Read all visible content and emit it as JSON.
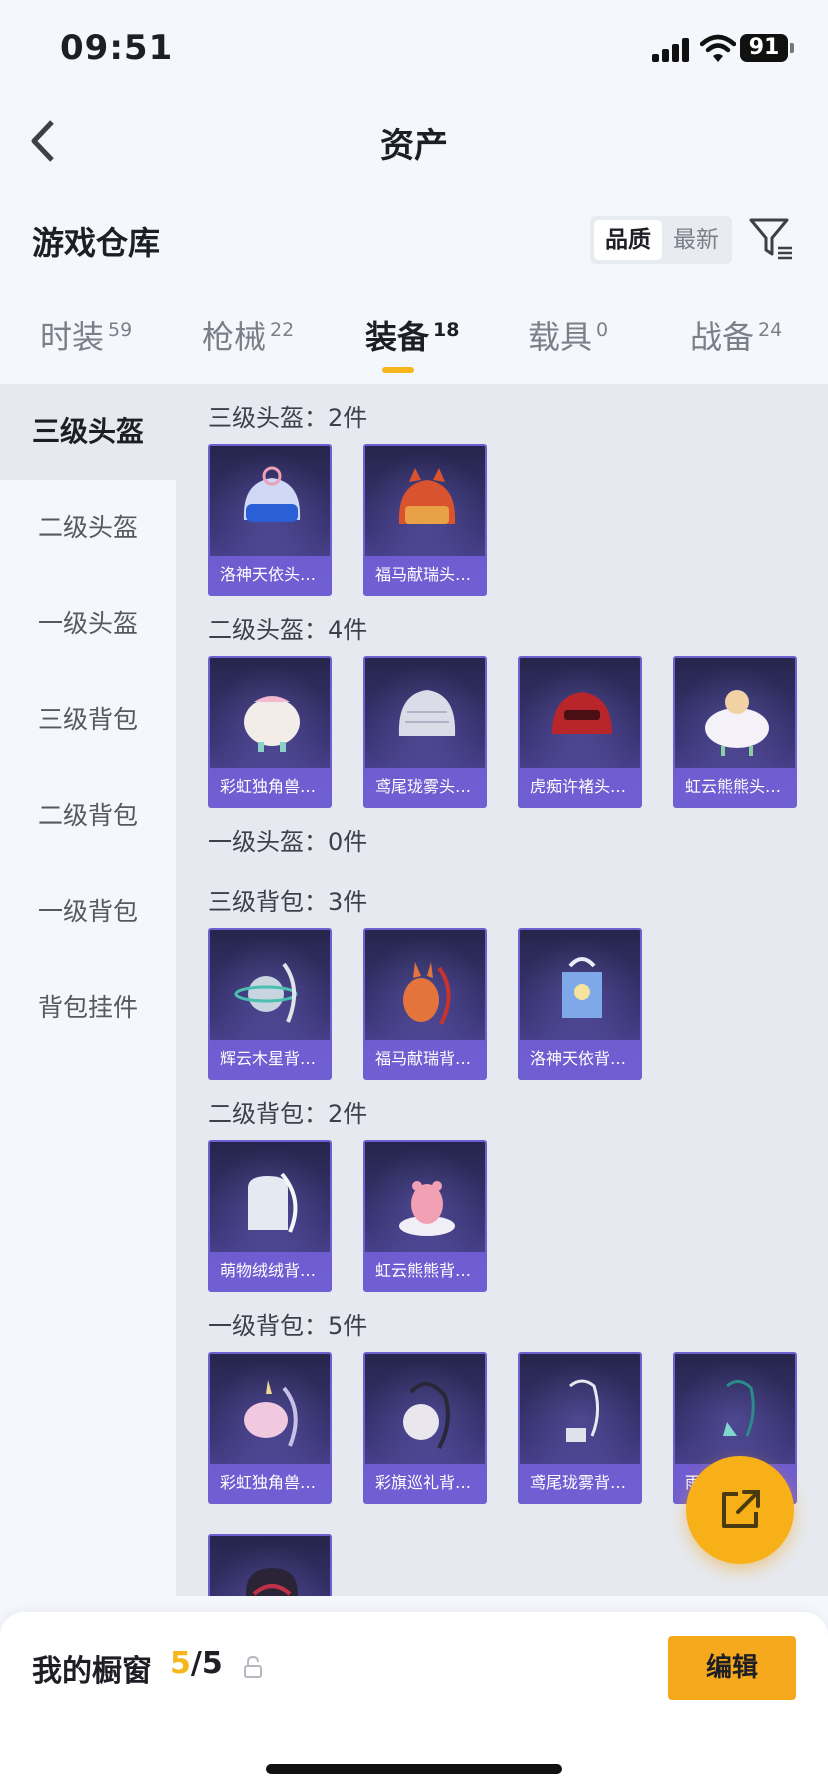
{
  "status": {
    "time": "09:51",
    "battery": "91"
  },
  "nav": {
    "title": "资产"
  },
  "warehouse": {
    "title": "游戏仓库",
    "sort_options": [
      "品质",
      "最新"
    ]
  },
  "tabs": [
    {
      "label": "时装",
      "count": "59"
    },
    {
      "label": "枪械",
      "count": "22"
    },
    {
      "label": "装备",
      "count": "18"
    },
    {
      "label": "载具",
      "count": "0"
    },
    {
      "label": "战备",
      "count": "24"
    }
  ],
  "sidebar": {
    "items": [
      {
        "label": "三级头盔"
      },
      {
        "label": "二级头盔"
      },
      {
        "label": "一级头盔"
      },
      {
        "label": "三级背包"
      },
      {
        "label": "二级背包"
      },
      {
        "label": "一级背包"
      },
      {
        "label": "背包挂件"
      }
    ]
  },
  "sections": [
    {
      "title": "三级头盔：2件",
      "items": [
        "洛神天依头…",
        "福马献瑞头…"
      ]
    },
    {
      "title": "二级头盔：4件",
      "items": [
        "彩虹独角兽…",
        "鸢尾珑雾头…",
        "虎痴许褚头…",
        "虹云熊熊头…"
      ]
    },
    {
      "title": "一级头盔：0件",
      "items": []
    },
    {
      "title": "三级背包：3件",
      "items": [
        "辉云木星背…",
        "福马献瑞背…",
        "洛神天依背…"
      ]
    },
    {
      "title": "二级背包：2件",
      "items": [
        "萌物绒绒背…",
        "虹云熊熊背…"
      ]
    },
    {
      "title": "一级背包：5件",
      "items": [
        "彩虹独角兽…",
        "彩旗巡礼背…",
        "鸢尾珑雾背…",
        "雨…",
        ""
      ]
    }
  ],
  "showcase": {
    "title": "我的橱窗",
    "used": "5",
    "total": "/5",
    "edit_label": "编辑"
  },
  "colors": {
    "accent": "#f6b61c",
    "card_border": "#6e60d0"
  }
}
